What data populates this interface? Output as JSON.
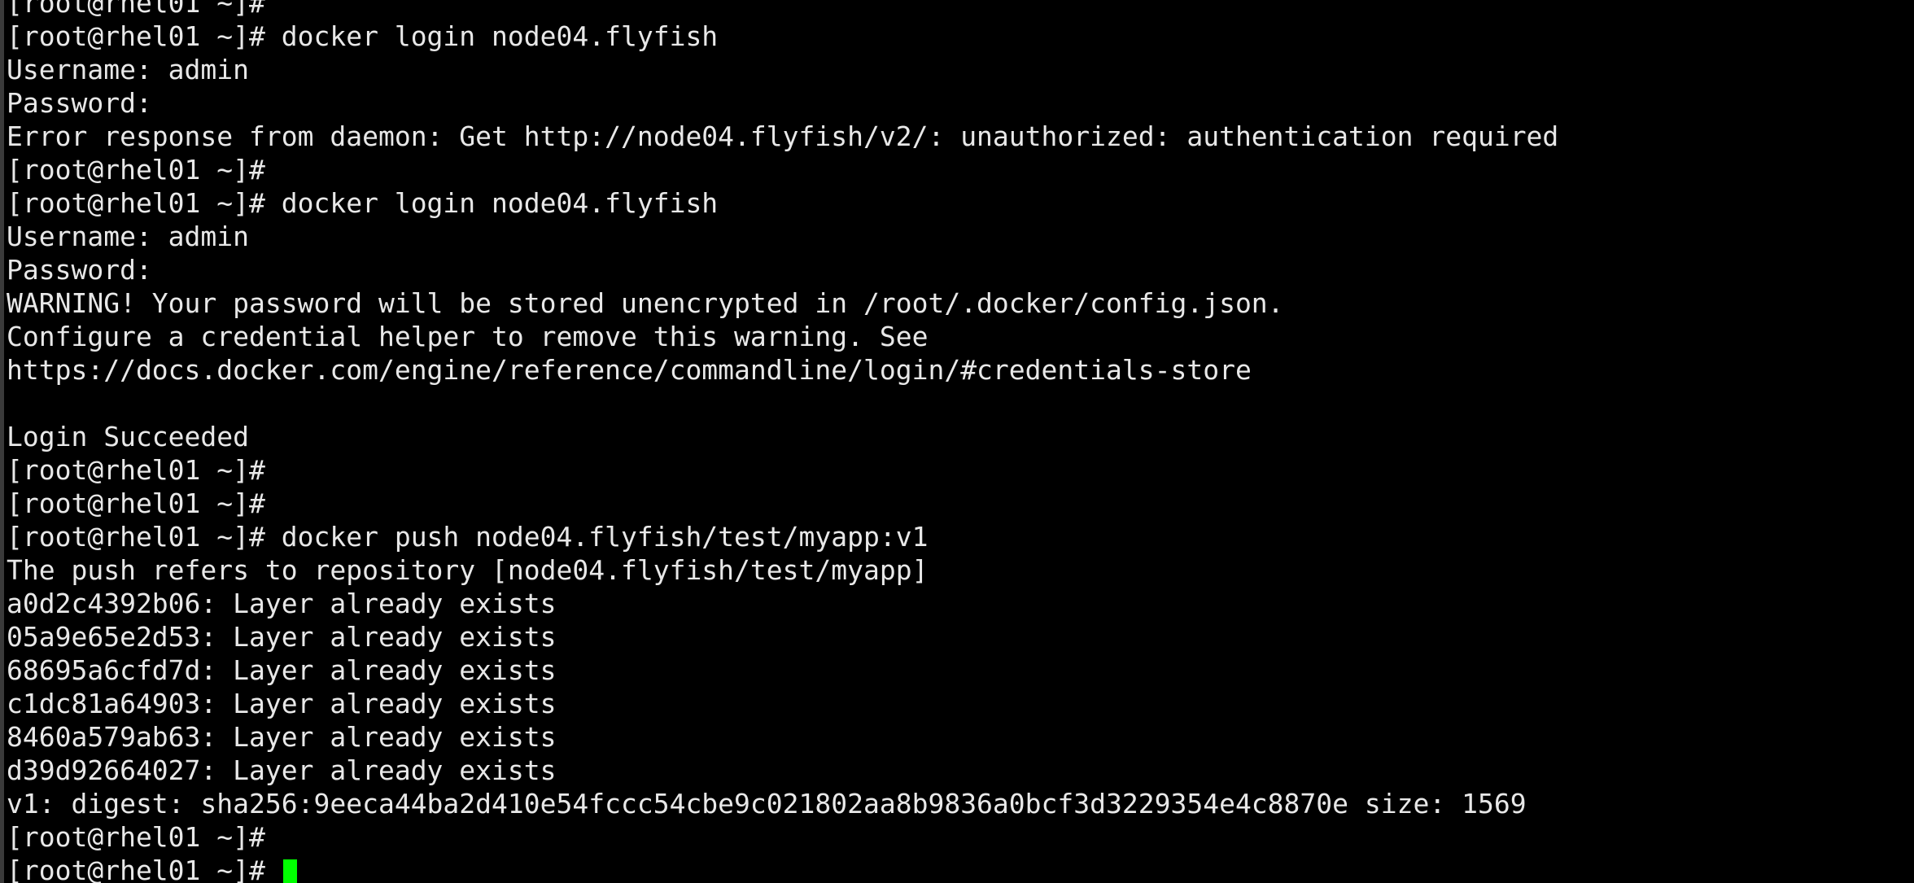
{
  "terminal": {
    "colors": {
      "background": "#000000",
      "foreground": "#e8e8e8",
      "cursor": "#00ff00",
      "left_edge": "#3a3a3a"
    },
    "prompt": "[root@rhel01 ~]#",
    "hostname": "rhel01",
    "user": "root",
    "cwd": "~",
    "lines": [
      "[root@rhel01 ~]#",
      "[root@rhel01 ~]# docker login node04.flyfish",
      "Username: admin",
      "Password:",
      "Error response from daemon: Get http://node04.flyfish/v2/: unauthorized: authentication required",
      "[root@rhel01 ~]#",
      "[root@rhel01 ~]# docker login node04.flyfish",
      "Username: admin",
      "Password:",
      "WARNING! Your password will be stored unencrypted in /root/.docker/config.json.",
      "Configure a credential helper to remove this warning. See",
      "https://docs.docker.com/engine/reference/commandline/login/#credentials-store",
      "",
      "Login Succeeded",
      "[root@rhel01 ~]#",
      "[root@rhel01 ~]#",
      "[root@rhel01 ~]# docker push node04.flyfish/test/myapp:v1",
      "The push refers to repository [node04.flyfish/test/myapp]",
      "a0d2c4392b06: Layer already exists",
      "05a9e65e2d53: Layer already exists",
      "68695a6cfd7d: Layer already exists",
      "c1dc81a64903: Layer already exists",
      "8460a579ab63: Layer already exists",
      "d39d92664027: Layer already exists",
      "v1: digest: sha256:9eeca44ba2d410e54fccc54cbe9c021802aa8b9836a0bcf3d3229354e4c8870e size: 1569",
      "[root@rhel01 ~]#"
    ],
    "current_line": {
      "prompt": "[root@rhel01 ~]# ",
      "input": "",
      "cursor_visible": true
    },
    "commands": [
      "docker login node04.flyfish",
      "docker login node04.flyfish",
      "docker push node04.flyfish/test/myapp:v1"
    ],
    "registry": "node04.flyfish",
    "image": "node04.flyfish/test/myapp:v1",
    "username_value": "admin",
    "digest": "sha256:9eeca44ba2d410e54fccc54cbe9c021802aa8b9836a0bcf3d3229354e4c8870e",
    "size": "1569",
    "layers": [
      "a0d2c4392b06",
      "05a9e65e2d53",
      "68695a6cfd7d",
      "c1dc81a64903",
      "8460a579ab63",
      "d39d92664027"
    ],
    "status_messages": [
      "Error response from daemon: Get http://node04.flyfish/v2/: unauthorized: authentication required",
      "Login Succeeded"
    ]
  }
}
